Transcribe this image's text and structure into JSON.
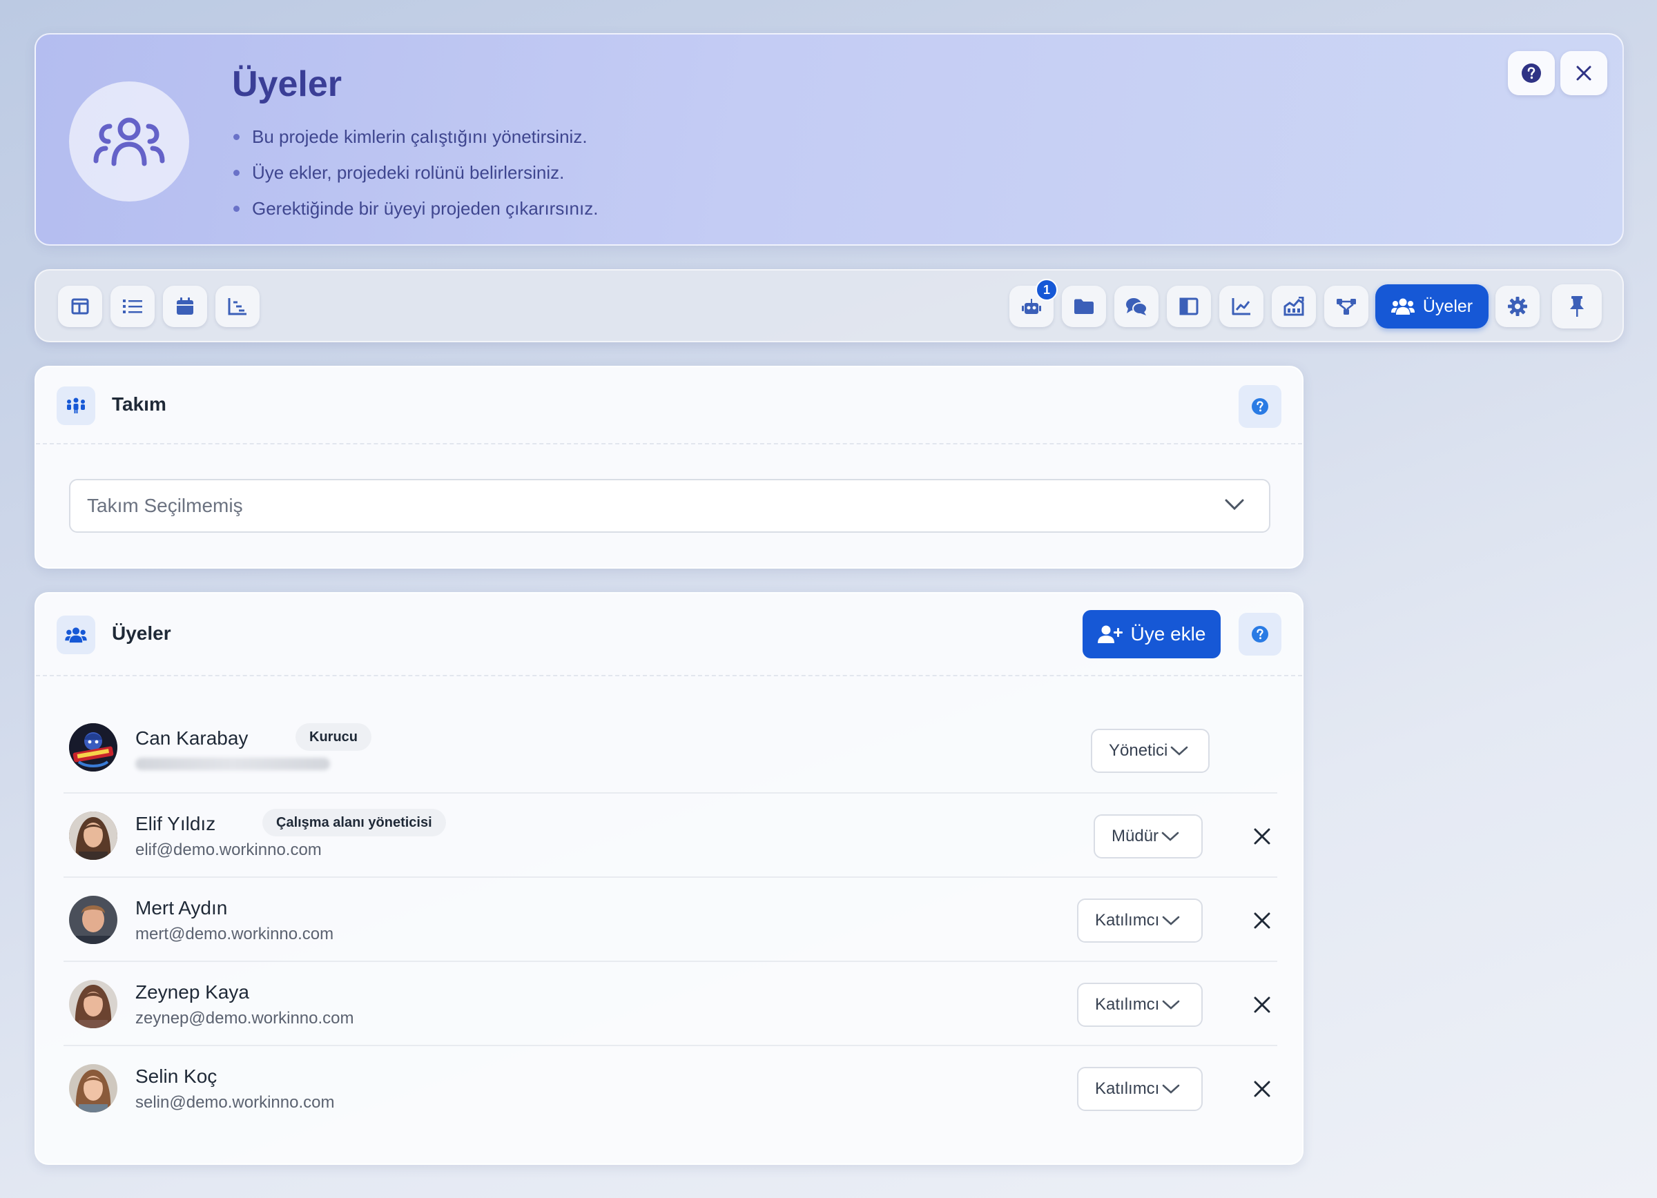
{
  "header": {
    "title": "Üyeler",
    "bullets": [
      "Bu projede kimlerin çalıştığını yönetirsiniz.",
      "Üye ekler, projedeki rolünü belirlersiniz.",
      "Gerektiğinde bir üyeyi projeden çıkarırsınız."
    ]
  },
  "toolbar": {
    "left_icons": [
      "board-icon",
      "list-icon",
      "calendar-icon",
      "gantt-icon"
    ],
    "right_icons": [
      "robot-icon",
      "folder-icon",
      "chat-icon",
      "book-icon",
      "chart-line-icon",
      "chart-area-icon",
      "diagram-icon"
    ],
    "notification_count": "1",
    "active_tab_label": "Üyeler"
  },
  "team_card": {
    "title": "Takım",
    "select_placeholder": "Takım Seçilmemiş"
  },
  "members_card": {
    "title": "Üyeler",
    "add_button_label": "Üye ekle",
    "members": [
      {
        "name": "Can Karabay",
        "tag": "Kurucu",
        "email": "",
        "role": "Yönetici"
      },
      {
        "name": "Elif Yıldız",
        "tag": "Çalışma alanı yöneticisi",
        "email": "elif@demo.workinno.com",
        "role": "Müdür"
      },
      {
        "name": "Mert Aydın",
        "tag": "",
        "email": "mert@demo.workinno.com",
        "role": "Katılımcı"
      },
      {
        "name": "Zeynep Kaya",
        "tag": "",
        "email": "zeynep@demo.workinno.com",
        "role": "Katılımcı"
      },
      {
        "name": "Selin Koç",
        "tag": "",
        "email": "selin@demo.workinno.com",
        "role": "Katılımcı"
      }
    ]
  },
  "colors": {
    "accent": "#1658d6",
    "banner_title": "#3a3e96",
    "icon_purple": "#6462c8"
  }
}
